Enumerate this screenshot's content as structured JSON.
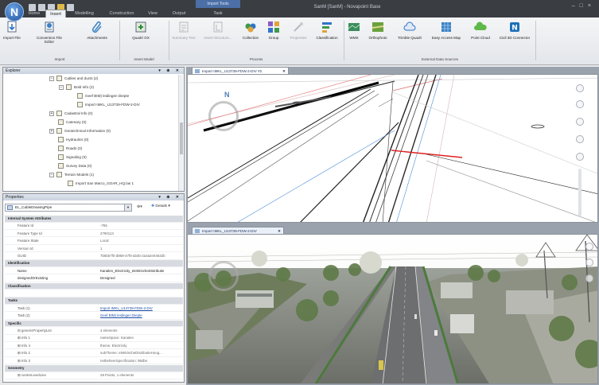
{
  "app": {
    "logo_letter": "N",
    "window_title": "SanM [SanM] - Novapoint Base",
    "context_tab_group": "Import Tools",
    "tabs": [
      "Home",
      "Insert",
      "Modelling",
      "Construction",
      "View",
      "Output",
      "Task"
    ],
    "active_tab": "Insert"
  },
  "ribbon": {
    "import_group": {
      "label": "Import",
      "buttons": [
        {
          "label": "Import File",
          "icon": "import-file-icon"
        },
        {
          "label": "Conversion File Editor",
          "icon": "conversion-editor-icon"
        },
        {
          "label": "Attachments",
          "icon": "paperclip-icon"
        }
      ]
    },
    "model_group": {
      "label": "Insert Model",
      "buttons": [
        {
          "label": "Quadri GX",
          "icon": "quadri-icon"
        }
      ]
    },
    "process_group": {
      "label": "Process",
      "buttons": [
        {
          "label": "Summary Text",
          "icon": "summary-text-icon",
          "disabled": true
        },
        {
          "label": "Insert Structure...",
          "icon": "insert-structure-icon",
          "disabled": true
        },
        {
          "label": "Collection",
          "icon": "collection-icon"
        },
        {
          "label": "Group",
          "icon": "group-icon"
        },
        {
          "label": "Properties",
          "icon": "properties-icon",
          "disabled": true
        },
        {
          "label": "Classification",
          "icon": "classification-icon"
        }
      ]
    },
    "external_group": {
      "label": "External Data Sources",
      "buttons": [
        {
          "label": "WMS",
          "icon": "wms-icon"
        },
        {
          "label": "Orthophoto",
          "icon": "orthophoto-icon"
        },
        {
          "label": "Trimble Quadri",
          "icon": "trimble-cloud-icon"
        },
        {
          "label": "Easy Access Map",
          "icon": "map-icon"
        },
        {
          "label": "Point Cloud",
          "icon": "point-cloud-icon"
        },
        {
          "label": "Civil 3D Connector",
          "icon": "civil3d-icon"
        }
      ]
    }
  },
  "explorer": {
    "title": "Explorer",
    "items": [
      {
        "label": "Cables and ducts (2)",
        "indent": 1,
        "expander": "minus"
      },
      {
        "label": "Bold Info (2)",
        "indent": 2,
        "expander": "minus"
      },
      {
        "label": "Geef BIM) leidingen Diepte",
        "indent": 3,
        "expander": ""
      },
      {
        "label": "Import IMKL_U13739-FDW-2-DIV",
        "indent": 3,
        "expander": ""
      },
      {
        "label": "Cadastral Info (0)",
        "indent": 1,
        "expander": "plus"
      },
      {
        "label": "Catenary (0)",
        "indent": 1,
        "expander": ""
      },
      {
        "label": "Geotechnical Information (0)",
        "indent": 1,
        "expander": "plus"
      },
      {
        "label": "Hydraulics (0)",
        "indent": 1,
        "expander": ""
      },
      {
        "label": "Roads (0)",
        "indent": 1,
        "expander": ""
      },
      {
        "label": "Signaling (0)",
        "indent": 1,
        "expander": ""
      },
      {
        "label": "Survey Data (0)",
        "indent": 1,
        "expander": ""
      },
      {
        "label": "Terrain Models (1)",
        "indent": 1,
        "expander": "minus"
      },
      {
        "label": "Import San Marco_GOAR_HQ.las 1",
        "indent": 2,
        "expander": ""
      }
    ]
  },
  "properties": {
    "title": "Properties",
    "selected_object": "EL_CableDrawingPipe",
    "details_label": "Details",
    "rows": [
      {
        "type": "cat",
        "key": "Internal System Attributes",
        "value": ""
      },
      {
        "type": "row",
        "key": "Feature Id",
        "value": "-755"
      },
      {
        "type": "row",
        "key": "Feature Type Id",
        "value": "2790113"
      },
      {
        "type": "row",
        "key": "Feature State",
        "value": "Local"
      },
      {
        "type": "row",
        "key": "Version Id",
        "value": "1"
      },
      {
        "type": "row",
        "key": "GUID",
        "value": "7b6b57f0-d869-47f0-ab4b-2a3a2e04632b"
      },
      {
        "type": "cat",
        "key": "Identification",
        "value": ""
      },
      {
        "type": "em",
        "key": "Name",
        "value": "Kanalen_Electricity_elektrischeDistributie"
      },
      {
        "type": "em",
        "key": "designedOrExisting",
        "value": "Designed"
      },
      {
        "type": "cat",
        "key": "Classification",
        "value": ""
      },
      {
        "type": "blank",
        "key": "",
        "value": ""
      },
      {
        "type": "cat",
        "key": "Tasks",
        "value": ""
      },
      {
        "type": "link",
        "key": "Task (1)",
        "value": "Import IMKL_U13739-FDW-2-DIV"
      },
      {
        "type": "link",
        "key": "Task (2)",
        "value": "Geef BIM) leidingen Diepte"
      },
      {
        "type": "cat",
        "key": "Specific",
        "value": ""
      },
      {
        "type": "row",
        "key": "⊟ genericPropertyList",
        "value": "4 elements"
      },
      {
        "type": "row",
        "key": "⊞ Info 1",
        "value": "nameSpace: Kanalen"
      },
      {
        "type": "row",
        "key": "⊞ Info 4",
        "value": "theme: Electricity"
      },
      {
        "type": "row",
        "key": "⊞ Info 2",
        "value": "subTheme: elektrischeDistributieHoog..."
      },
      {
        "type": "row",
        "key": "⊞ Info 3",
        "value": "netbeheerSpecification: 95dbe"
      },
      {
        "type": "cat",
        "key": "Geometry",
        "value": ""
      },
      {
        "type": "row",
        "key": "⊞ centreLevelLine",
        "value": "28 Points, 1 elements"
      }
    ]
  },
  "viewports": {
    "top": {
      "tab": "Import IMKL_U13739-FDW-2-DIV #2"
    },
    "bottom": {
      "tab": "Import IMKL_U13739-FDW-2-DIV"
    },
    "north_label": "N"
  },
  "colors": {
    "titlebar": "#3a3d42",
    "ribbon": "#eceef1",
    "panel_header": "#d5dce6",
    "link": "#1f4fa8"
  }
}
